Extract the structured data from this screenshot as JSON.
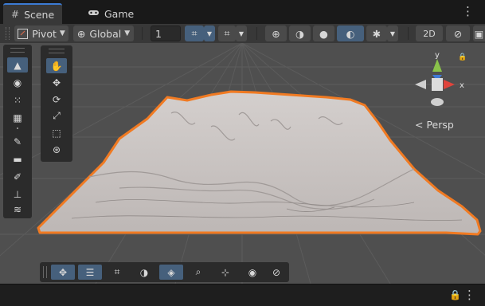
{
  "tabs": {
    "scene": {
      "label": "Scene",
      "icon": "grid-icon"
    },
    "game": {
      "label": "Game",
      "icon": "gamepad-icon"
    },
    "menu": "⋮"
  },
  "toolbar": {
    "pivot_label": "Pivot",
    "global_label": "Global",
    "grid_size_value": "1",
    "icons": [
      "hand-cursor-icon",
      "snap-grid-icon",
      "snap-settings-icon",
      "wireframe-sphere-icon",
      "shaded-wireframe-icon",
      "shaded-sphere-icon",
      "lighting-icon",
      "gizmo-bug-icon",
      "2d-toggle-icon",
      "fx-icon",
      "camera-icon"
    ]
  },
  "viewport": {
    "persp_label": "< Persp",
    "gizmo": {
      "x_label": "x",
      "y_label": "y"
    },
    "selection_color": "#f07a22",
    "terrain_color": "#c9c3c1",
    "grid_color": "#5a5a5a"
  },
  "terrain_tools": [
    "raise-lower-icon",
    "sculpt-paint-icon",
    "smooth-holes-icon",
    "stamp-icon",
    "set-height-icon",
    "paint-texture-icon",
    "paint-trees-icon",
    "paint-details-icon",
    "terrain-settings-icon"
  ],
  "transform_tools": [
    "hand-tool-icon",
    "move-tool-icon",
    "rotate-tool-icon",
    "scale-tool-icon",
    "rect-tool-icon",
    "transform-tool-icon"
  ],
  "bottom_tools": [
    "move-overlay-icon",
    "layers-overlay-icon",
    "grid-overlay-icon",
    "shading-overlay-icon",
    "terrain-brush-icon",
    "search-overlay-icon",
    "pivot-overlay-icon",
    "visibility-overlay-icon",
    "compass-overlay-icon"
  ],
  "status": {
    "lock": "🔒",
    "menu": "⋮"
  }
}
